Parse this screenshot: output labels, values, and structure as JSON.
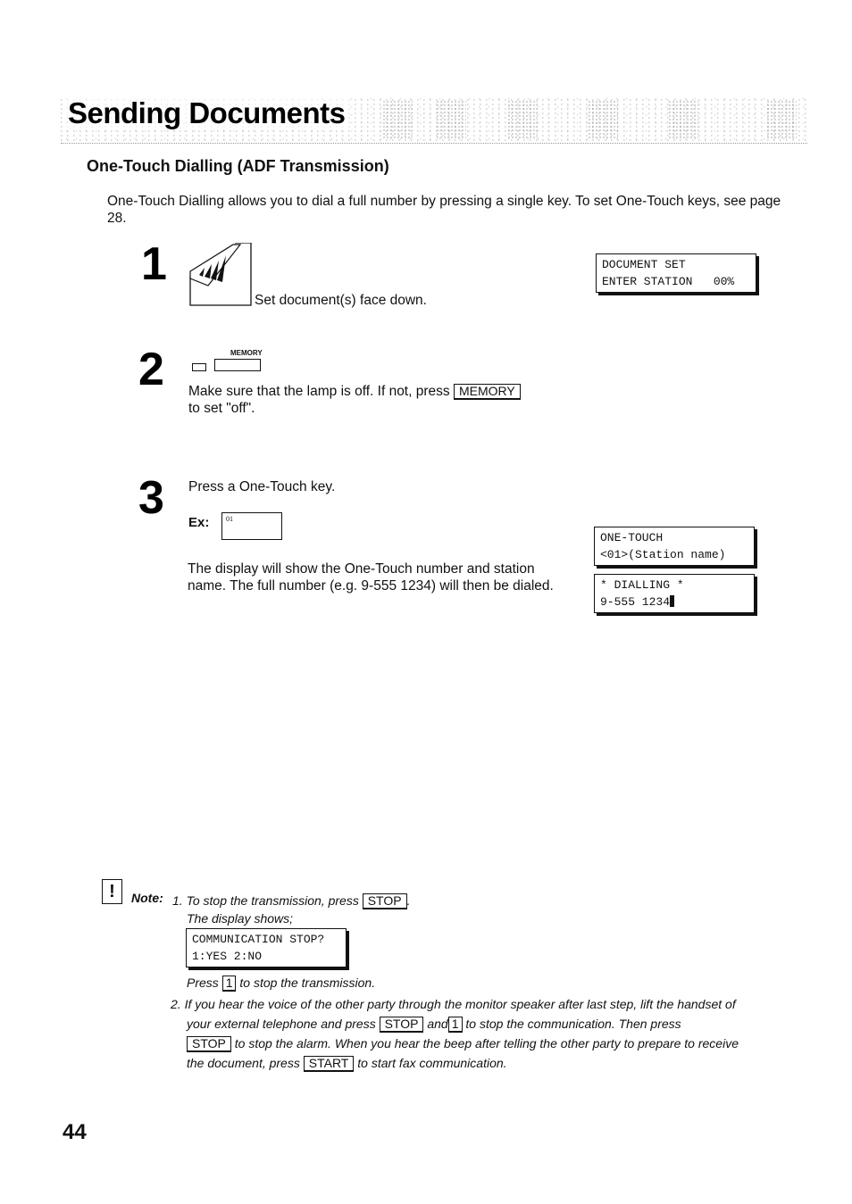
{
  "header": {
    "section_title": "Sending Documents",
    "subsection_title": "One-Touch Dialling (ADF Transmission)"
  },
  "intro": "One-Touch Dialling allows you to dial a full number by pressing a single key.  To set One-Touch keys, see page 28.",
  "steps": [
    {
      "number": "1",
      "icon": "document-feed-icon",
      "text": "Set document(s) face down.",
      "display": {
        "line1": "DOCUMENT SET",
        "line2": "ENTER STATION   00%"
      }
    },
    {
      "number": "2",
      "panel_label": "MEMORY",
      "text_before": "Make sure that the lamp is off. If not, press",
      "key": "MEMORY",
      "text_after": "to set \"off\"."
    },
    {
      "number": "3",
      "text": "Press a One-Touch key.",
      "example_label": "Ex:",
      "example_key": "01",
      "description": "The display will show the One-Touch number and station name.  The full number (e.g. 9-555 1234) will then be dialed.",
      "display_1": {
        "line1": "ONE-TOUCH",
        "line2": "<01>(Station name)"
      },
      "display_2": {
        "line1": "* DIALLING *",
        "line2": "9-555 1234"
      }
    }
  ],
  "note": {
    "label": "Note:",
    "items": [
      {
        "num": "1.",
        "text_before": "To stop the transmission, press",
        "key": "STOP",
        "text_after": ".",
        "line2": "The display shows;",
        "display": {
          "line1": "COMMUNICATION STOP?",
          "line2": "1:YES 2:NO"
        },
        "line3_before": "Press",
        "line3_key": "1",
        "line3_after": "to stop the transmission."
      },
      {
        "num": "2.",
        "l1": "If you hear the voice of the other party through the monitor speaker after last step, lift the handset of",
        "l2_before": "your external telephone and press",
        "l2_key1": "STOP",
        "l2_mid": "and",
        "l2_key2": "1",
        "l2_after": "to stop the communication. Then press",
        "l3_key": "STOP",
        "l3_after": "to stop the alarm. When you hear the beep after telling the other party to prepare to receive",
        "l4_before": "the document, press",
        "l4_key": "START",
        "l4_after": "to start fax communication."
      }
    ]
  },
  "page_number": "44"
}
